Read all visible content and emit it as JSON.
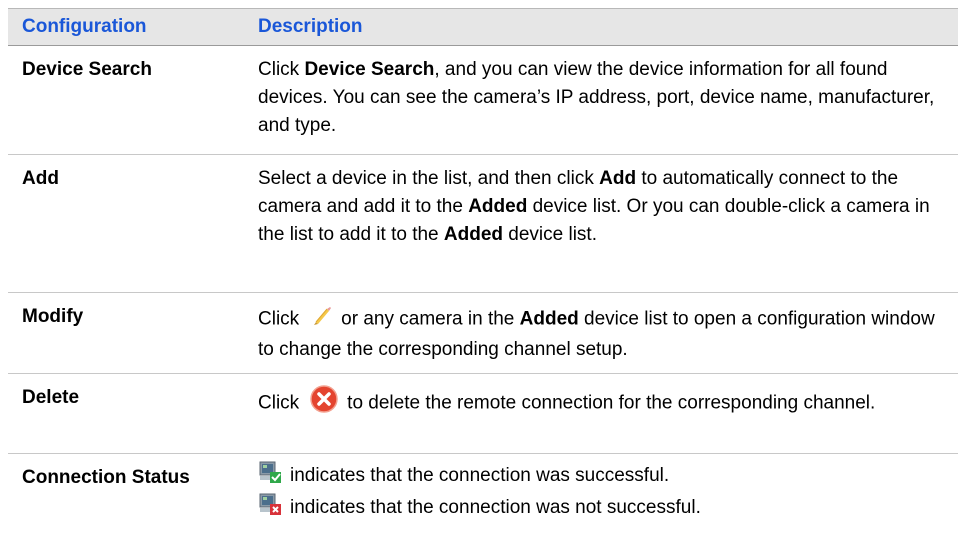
{
  "table": {
    "headers": {
      "configuration": "Configuration",
      "description": "Description"
    },
    "rows": {
      "device_search": {
        "name": "Device Search",
        "t1": "Click ",
        "b1": "Device Search",
        "t2": ", and you can view the device information for all found devices. You can see the camera’s IP address, port, device name, manufacturer, and type."
      },
      "add": {
        "name": "Add",
        "t1": "Select a device in the list, and then click ",
        "b1": "Add",
        "t2": " to automatically connect to the camera and add it to the ",
        "b2": "Added",
        "t3": " device list. Or you can double-click a camera in the list to add it to the ",
        "b3": "Added",
        "t4": " device list."
      },
      "modify": {
        "name": "Modify",
        "t1": "Click",
        "icon": "pencil-edit-icon",
        "t2": "or any camera in the ",
        "b1": "Added",
        "t3": " device list to open a configuration window to change the corresponding channel setup."
      },
      "delete": {
        "name": "Delete",
        "t1": "Click",
        "icon": "red-x-delete-icon",
        "t2": "to delete the remote connection for the corresponding channel."
      },
      "connection_status": {
        "name": "Connection Status",
        "ok_icon": "monitor-green-check-icon",
        "ok_text": "indicates that the connection was successful.",
        "fail_icon": "monitor-red-x-icon",
        "fail_text": "indicates that the connection was not successful."
      }
    }
  }
}
